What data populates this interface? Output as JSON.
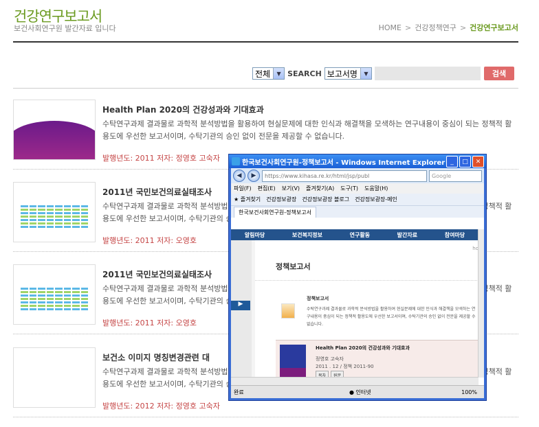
{
  "header": {
    "title": "건강연구보고서",
    "subtitle": "보건사회연구원 발간자료 입니다",
    "breadcrumb": [
      "HOME",
      "건강정책연구",
      "건강연구보고서"
    ]
  },
  "search": {
    "scope": "전체",
    "label": "SEARCH",
    "field": "보고서명",
    "button": "검색"
  },
  "items": [
    {
      "title": "Health Plan 2020의 건강성과와 기대효과",
      "desc": "수탁연구과제 결과물로 과학적 분석방법을 활용하여 현실문제에 대한 인식과 해결책을 모색하는 연구내용이 중심이 되는 정책적 활용도에 우선한 보고서이며, 수탁기관의 승인 없이 전문을 제공할 수 없습니다.",
      "meta": "발행년도: 2011 저자: 정영호 고숙자"
    },
    {
      "title": "2011년 국민보건의료실태조사",
      "desc": "수탁연구과제 결과물로 과학적 분석방법을 활용하여 현실문제에 대한 인식과 해결책을 모색하는 연구내용이 중심이 되는 정책적 활용도에 우선한 보고서이며, 수탁기관의 승인 없이 전문을 제공할 수 없습니다.",
      "meta": "발행년도: 2011 저자: 오영호"
    },
    {
      "title": "2011년 국민보건의료실태조사",
      "desc": "수탁연구과제 결과물로 과학적 분석방법을 활용하여 현실문제에 대한 인식과 해결책을 모색하는 연구내용이 중심이 되는 정책적 활용도에 우선한 보고서이며, 수탁기관의 승인 없이 전문을 제공할 수 없습니다.",
      "meta": "발행년도: 2011 저자: 오영호"
    },
    {
      "title": "보건소 이미지 명칭변경관련 대",
      "desc": "수탁연구과제 결과물로 과학적 분석방법을 활용하여 현실문제에 대한 인식과 해결책을 모색하는 연구내용이 중심이 되는 정책적 활용도에 우선한 보고서이며, 수탁기관의 승인 없이 전문을 제공할 수 없습니다.",
      "meta": "발행년도: 2012 저자: 정영호 고숙자"
    }
  ],
  "ie": {
    "title": "한국보건사회연구원-정책보고서 - Windows Internet Explorer",
    "url": "https://www.kihasa.re.kr/html/jsp/publ",
    "search_placeholder": "Google",
    "menu": [
      "파일(F)",
      "편집(E)",
      "보기(V)",
      "즐겨찾기(A)",
      "도구(T)",
      "도움말(H)"
    ],
    "favorites": [
      "즐겨찾기",
      "건강정보광장",
      "건강정보광장 블로그",
      "건강정보광장-메인"
    ],
    "tab": "한국보건사회연구원-정책보고서",
    "nav": [
      "알림마당",
      "보건복지정보",
      "연구활동",
      "발간자료",
      "참여마당"
    ],
    "open_label": "open",
    "home_label": "ho",
    "heading": "정책보고서",
    "section": "정책보고서",
    "section_desc": "수탁연구과제 결과물로 과학적 분석방법을 활용하여 현실문제에 대한 인식과 해결책을 모색하는 연구내용이 중심이 되는 정책적 활용도에 우선한 보고서이며, 수탁기관의 승인 없이 전문을 제공할 수 없습니다.",
    "card_title": "Health Plan 2020의 건강성과와 기대효과",
    "card_author": "정영호 고숙자",
    "card_date": "2011 . 12 / 정책 2011-90",
    "card_buttons": [
      "목차",
      "원문"
    ],
    "status": "완료",
    "zone": "인터넷",
    "zoom": "100%"
  }
}
